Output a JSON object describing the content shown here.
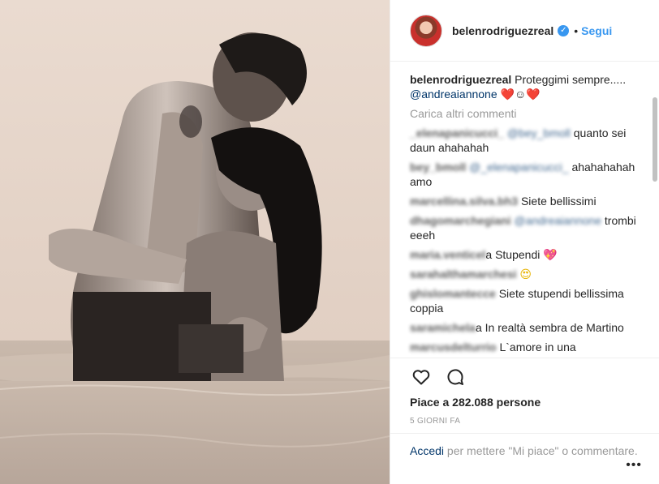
{
  "post": {
    "username": "belenrodriguezreal",
    "follow_label": "Segui",
    "dot": "•",
    "verified_glyph": "✓",
    "caption": {
      "author": "belenrodriguezreal",
      "text": "Proteggimi sempre.....",
      "mention": "@andreaiannone",
      "emojis_heart": "❤️",
      "emoji_smile": "☺",
      "emojis_heart2": "❤️"
    },
    "load_more": "Carica altri commenti",
    "comments": [
      {
        "user": "_elenapanicucci_",
        "mention": "@bey_bmoll",
        "text": "quanto sei daun ahahahah"
      },
      {
        "user": "bey_bmoll",
        "mention": "@_elenapanicucci_",
        "text": "ahahahahah amo"
      },
      {
        "user": "marcellina.silva.bh3",
        "mention": "",
        "text": "Siete bellissimi"
      },
      {
        "user": "dhagomarchegiani",
        "mention": "@andreaiannone",
        "text": "trombi eeeh"
      },
      {
        "user": "maria.venticel",
        "mention": "",
        "text": "a Stupendi",
        "emoji": "💖"
      },
      {
        "user": "sarahalthamarchesi",
        "mention": "",
        "text": "",
        "emoji": "😍"
      },
      {
        "user": "ghislomantecce",
        "mention": "",
        "text": "Siete stupendi bellissima coppia"
      },
      {
        "user": "saramichela",
        "mention": "",
        "text": "a In realtà sembra de Martino"
      },
      {
        "user": "marcusdelturrio",
        "mention": "",
        "text": "L`amore in una"
      }
    ],
    "likes": "Piace a 282.088 persone",
    "timestamp": "5 GIORNI FA",
    "login_link": "Accedi",
    "login_text": "per mettere \"Mi piace\" o commentare.",
    "more_options": "•••"
  },
  "icons": {
    "like": "heart-outline-icon",
    "comment": "speech-bubble-icon",
    "more": "more-options-icon"
  },
  "colors": {
    "accent": "#3897f0",
    "mention": "#003569",
    "muted": "#999999"
  }
}
